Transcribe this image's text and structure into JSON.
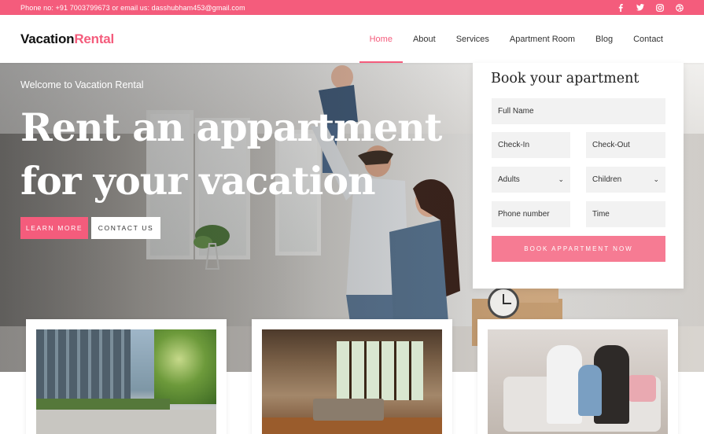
{
  "topbar": {
    "contact_text": "Phone no: +91 7003799673 or email us: dasshubham453@gmail.com",
    "socials": [
      "facebook-icon",
      "twitter-icon",
      "instagram-icon",
      "dribbble-icon"
    ]
  },
  "header": {
    "logo_main": "Vacation",
    "logo_accent": "Rental",
    "nav": [
      {
        "label": "Home",
        "active": true
      },
      {
        "label": "About",
        "active": false
      },
      {
        "label": "Services",
        "active": false
      },
      {
        "label": "Apartment Room",
        "active": false
      },
      {
        "label": "Blog",
        "active": false
      },
      {
        "label": "Contact",
        "active": false
      }
    ]
  },
  "hero": {
    "welcome": "Welcome to Vacation Rental",
    "headline_line1": "Rent an appartment",
    "headline_line2": "for your vacation",
    "learn_more": "LEARN MORE",
    "contact_us": "CONTACT US"
  },
  "booking": {
    "title": "Book your apartment",
    "full_name": "Full Name",
    "check_in": "Check-In",
    "check_out": "Check-Out",
    "adults": "Adults",
    "children": "Children",
    "phone": "Phone number",
    "time": "Time",
    "submit": "BOOK APPARTMENT NOW"
  },
  "colors": {
    "accent": "#f45c7c",
    "button_light": "#f67b93"
  }
}
